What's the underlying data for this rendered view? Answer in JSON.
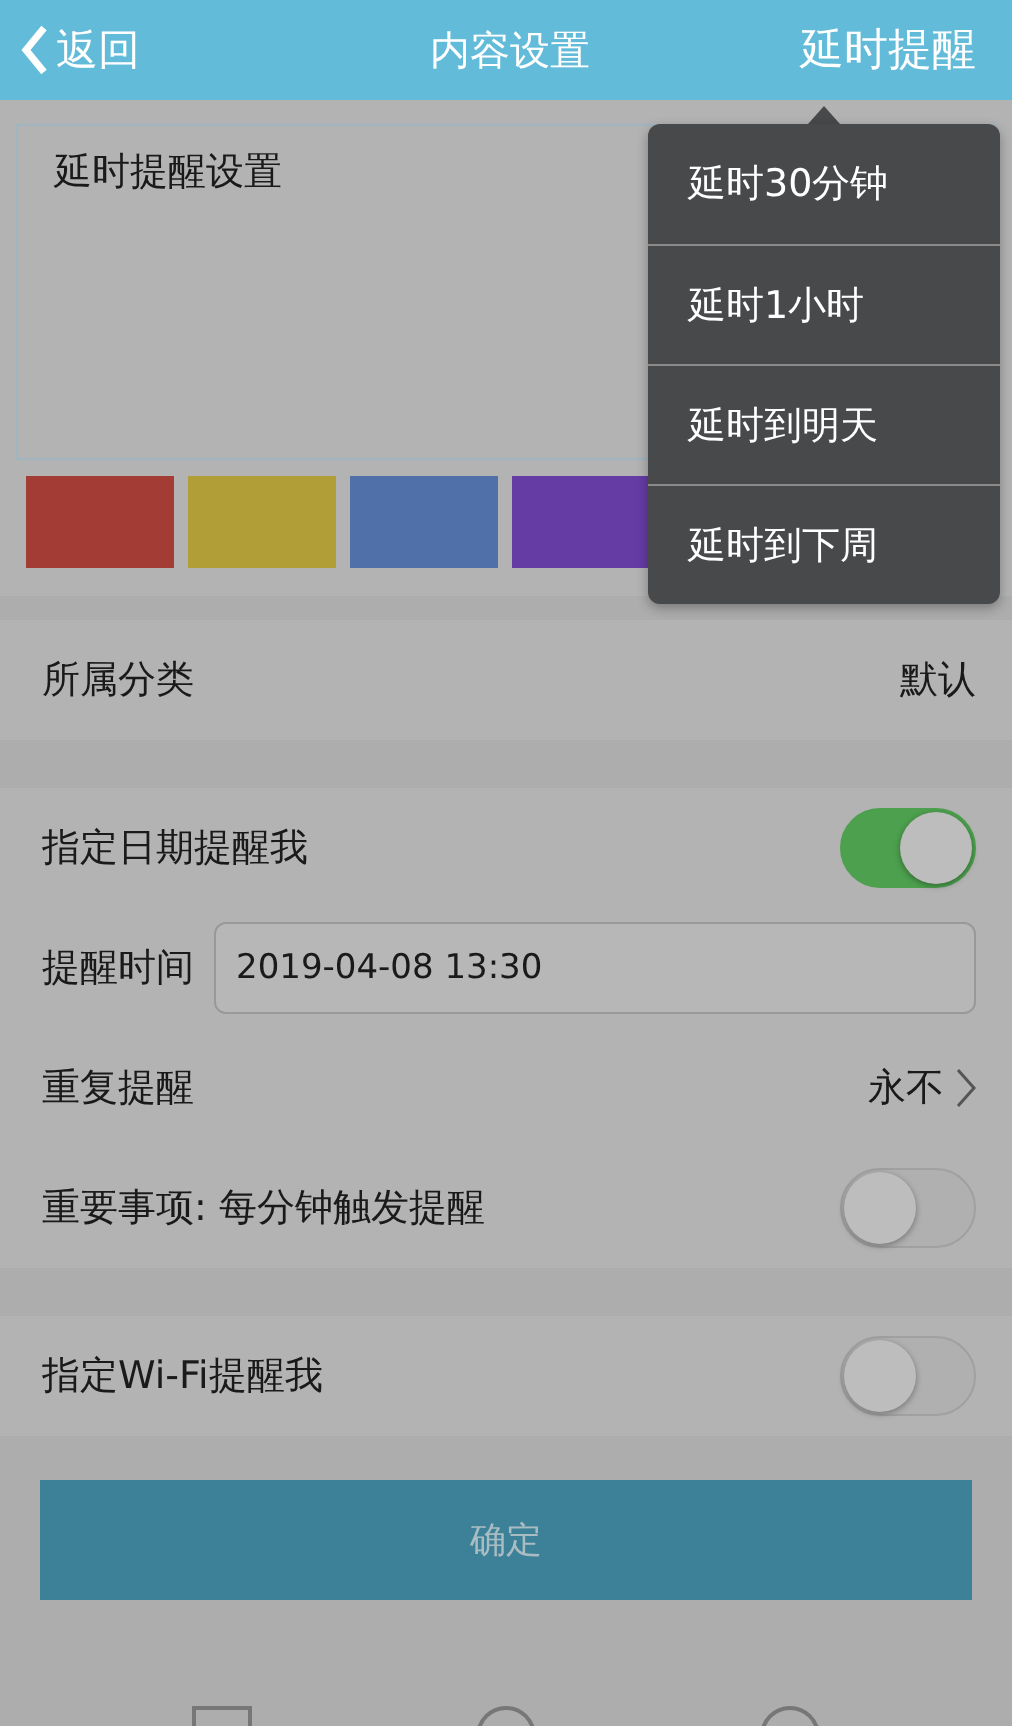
{
  "header": {
    "back": "返回",
    "title": "内容设置",
    "action": "延时提醒"
  },
  "note": {
    "value": "延时提醒设置"
  },
  "colors": [
    {
      "color": "#a43c36"
    },
    {
      "color": "#b19e36"
    },
    {
      "color": "#4f70a8"
    },
    {
      "color": "#653ca4"
    }
  ],
  "sections": [
    {
      "rows": [
        {
          "kind": "value",
          "label": "所属分类",
          "value": "默认"
        }
      ]
    },
    {
      "rows": [
        {
          "kind": "toggle",
          "label": "指定日期提醒我",
          "on": true
        },
        {
          "kind": "field",
          "label": "提醒时间",
          "value": "2019-04-08 13:30"
        },
        {
          "kind": "link",
          "label": "重复提醒",
          "value": "永不"
        },
        {
          "kind": "toggle",
          "label": "重要事项: 每分钟触发提醒",
          "on": false
        }
      ]
    },
    {
      "rows": [
        {
          "kind": "toggle",
          "label": "指定Wi-Fi提醒我",
          "on": false
        }
      ]
    }
  ],
  "confirm": "确定",
  "menu": {
    "items": [
      "延时30分钟",
      "延时1小时",
      "延时到明天",
      "延时到下周"
    ]
  }
}
